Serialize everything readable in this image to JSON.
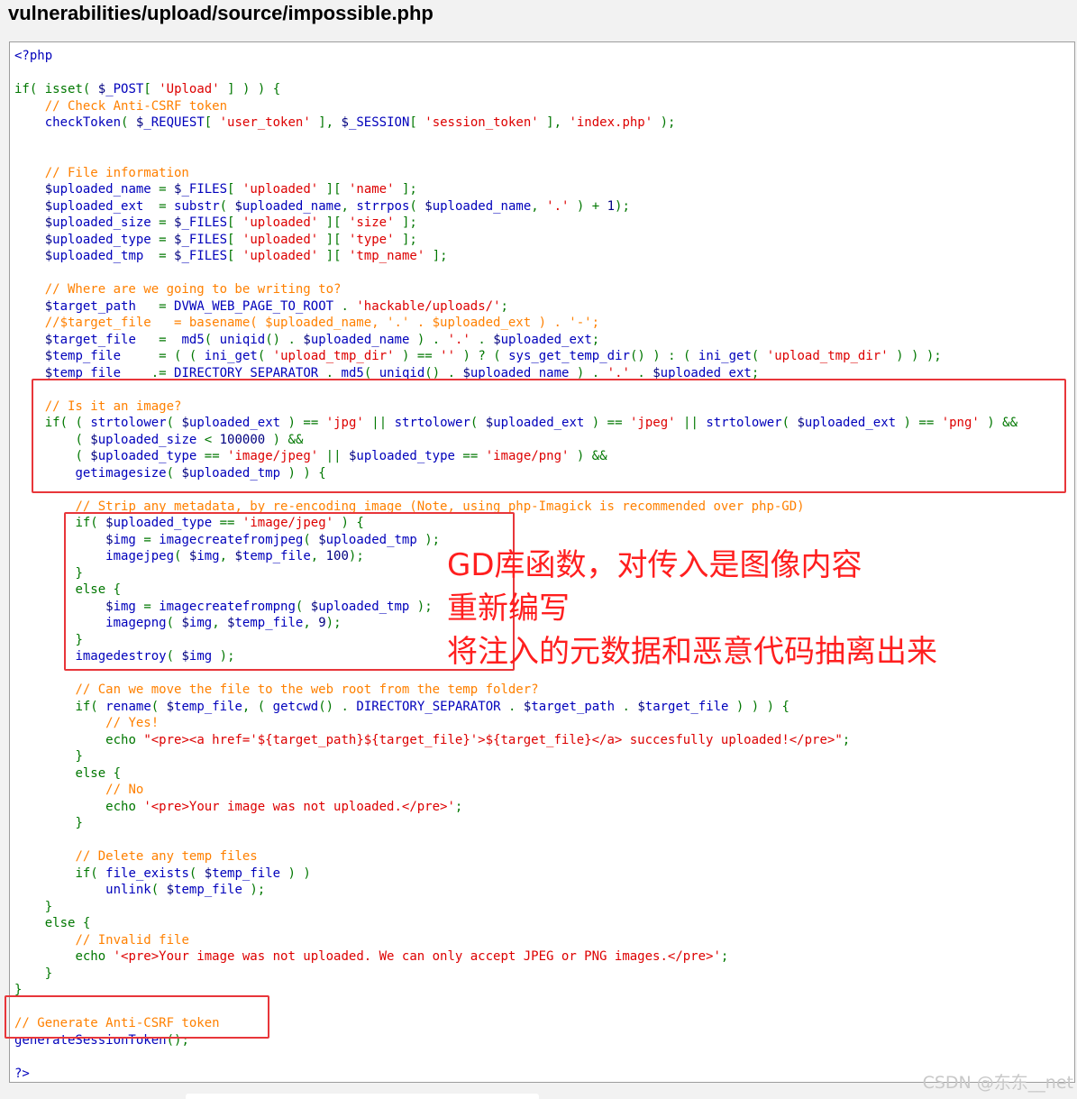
{
  "header": {
    "title": "vulnerabilities/upload/source/impossible.php"
  },
  "code_lines": [
    "<?php",
    "",
    "if( isset( $_POST[ 'Upload' ] ) ) {",
    "    // Check Anti-CSRF token",
    "    checkToken( $_REQUEST[ 'user_token' ], $_SESSION[ 'session_token' ], 'index.php' );",
    "",
    "",
    "    // File information",
    "    $uploaded_name = $_FILES[ 'uploaded' ][ 'name' ];",
    "    $uploaded_ext  = substr( $uploaded_name, strrpos( $uploaded_name, '.' ) + 1);",
    "    $uploaded_size = $_FILES[ 'uploaded' ][ 'size' ];",
    "    $uploaded_type = $_FILES[ 'uploaded' ][ 'type' ];",
    "    $uploaded_tmp  = $_FILES[ 'uploaded' ][ 'tmp_name' ];",
    "",
    "    // Where are we going to be writing to?",
    "    $target_path   = DVWA_WEB_PAGE_TO_ROOT . 'hackable/uploads/';",
    "    //$target_file   = basename( $uploaded_name, '.' . $uploaded_ext ) . '-';",
    "    $target_file   =  md5( uniqid() . $uploaded_name ) . '.' . $uploaded_ext;",
    "    $temp_file     = ( ( ini_get( 'upload_tmp_dir' ) == '' ) ? ( sys_get_temp_dir() ) : ( ini_get( 'upload_tmp_dir' ) ) );",
    "    $temp_file    .= DIRECTORY_SEPARATOR . md5( uniqid() . $uploaded_name ) . '.' . $uploaded_ext;",
    "",
    "    // Is it an image?",
    "    if( ( strtolower( $uploaded_ext ) == 'jpg' || strtolower( $uploaded_ext ) == 'jpeg' || strtolower( $uploaded_ext ) == 'png' ) &&",
    "        ( $uploaded_size < 100000 ) &&",
    "        ( $uploaded_type == 'image/jpeg' || $uploaded_type == 'image/png' ) &&",
    "        getimagesize( $uploaded_tmp ) ) {",
    "",
    "        // Strip any metadata, by re-encoding image (Note, using php-Imagick is recommended over php-GD)",
    "        if( $uploaded_type == 'image/jpeg' ) {",
    "            $img = imagecreatefromjpeg( $uploaded_tmp );",
    "            imagejpeg( $img, $temp_file, 100);",
    "        }",
    "        else {",
    "            $img = imagecreatefrompng( $uploaded_tmp );",
    "            imagepng( $img, $temp_file, 9);",
    "        }",
    "        imagedestroy( $img );",
    "",
    "        // Can we move the file to the web root from the temp folder?",
    "        if( rename( $temp_file, ( getcwd() . DIRECTORY_SEPARATOR . $target_path . $target_file ) ) ) {",
    "            // Yes!",
    "            echo \"<pre><a href='${target_path}${target_file}'>${target_file}</a> succesfully uploaded!</pre>\";",
    "        }",
    "        else {",
    "            // No",
    "            echo '<pre>Your image was not uploaded.</pre>';",
    "        }",
    "",
    "        // Delete any temp files",
    "        if( file_exists( $temp_file ) )",
    "            unlink( $temp_file );",
    "    }",
    "    else {",
    "        // Invalid file",
    "        echo '<pre>Your image was not uploaded. We can only accept JPEG or PNG images.</pre>';",
    "    }",
    "}",
    "",
    "// Generate Anti-CSRF token",
    "generateSessionToken();",
    "",
    "?>"
  ],
  "annotation": {
    "line1": "GD库函数，对传入是图像内容",
    "line2": "重新编写",
    "line3": "将注入的元数据和恶意代码抽离出来"
  },
  "watermark": "CSDN @东东__net",
  "colors": {
    "comment": "#ff8000",
    "string": "#dd0000",
    "keyword": "#007700",
    "default": "#0000bb",
    "annotation_red": "#ff1f1f",
    "highlight_box": "#e8363a"
  }
}
